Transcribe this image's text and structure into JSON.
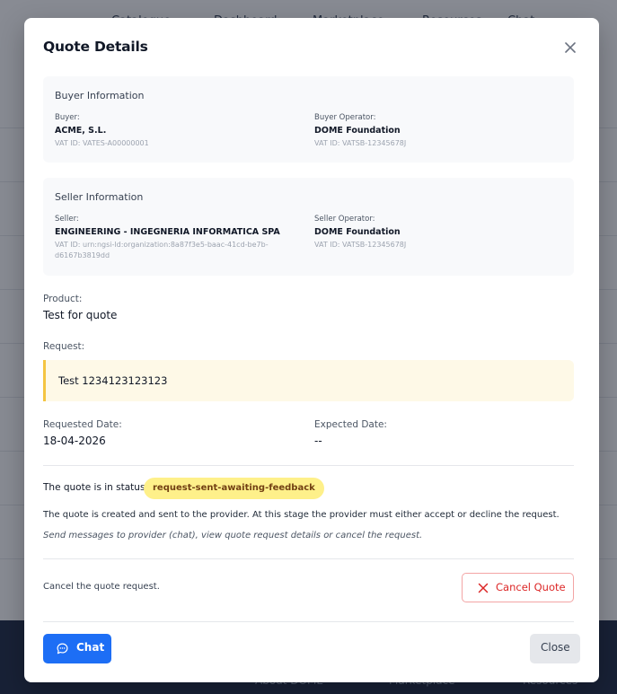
{
  "background": {
    "nav_items": [
      "Catalogue",
      "Dashboard",
      "Marketplace",
      "Resources",
      "Chat"
    ],
    "footer_links": [
      "About DOME",
      "Marketplace",
      "Resources"
    ]
  },
  "modal": {
    "title": "Quote Details",
    "buyer": {
      "section_title": "Buyer Information",
      "buyer_label": "Buyer:",
      "buyer_name": "ACME, S.L.",
      "buyer_vat": "VAT ID: VATES-A00000001",
      "operator_label": "Buyer Operator:",
      "operator_name": "DOME Foundation",
      "operator_vat": "VAT ID: VATSB-12345678J"
    },
    "seller": {
      "section_title": "Seller Information",
      "seller_label": "Seller:",
      "seller_name": "ENGINEERING - INGEGNERIA INFORMATICA SPA",
      "seller_vat": "VAT ID: urn:ngsi-ld:organization:8a87f3e5-baac-41cd-be7b-d6167b3819dd",
      "operator_label": "Seller Operator:",
      "operator_name": "DOME Foundation",
      "operator_vat": "VAT ID: VATSB-12345678J"
    },
    "product_label": "Product:",
    "product_value": "Test for quote",
    "request_label": "Request:",
    "request_value": "Test 1234123123123",
    "requested_date_label": "Requested Date:",
    "requested_date_value": "18-04-2026",
    "expected_date_label": "Expected Date:",
    "expected_date_value": "--",
    "status_prefix": "The quote is in status:",
    "status_value": "request-sent-awaiting-feedback",
    "status_description": "The quote is created and sent to the provider. At this stage the provider must either accept or decline the request.",
    "status_hint": "Send messages to provider (chat), view quote request details or cancel the request.",
    "cancel_text": "Cancel the quote request.",
    "cancel_button": "Cancel Quote",
    "chat_button": "Chat",
    "close_button": "Close"
  },
  "colors": {
    "primary": "#1d6ef5",
    "danger": "#dc2626",
    "status_badge_bg": "#fef08a",
    "request_accent": "#f4c542"
  }
}
